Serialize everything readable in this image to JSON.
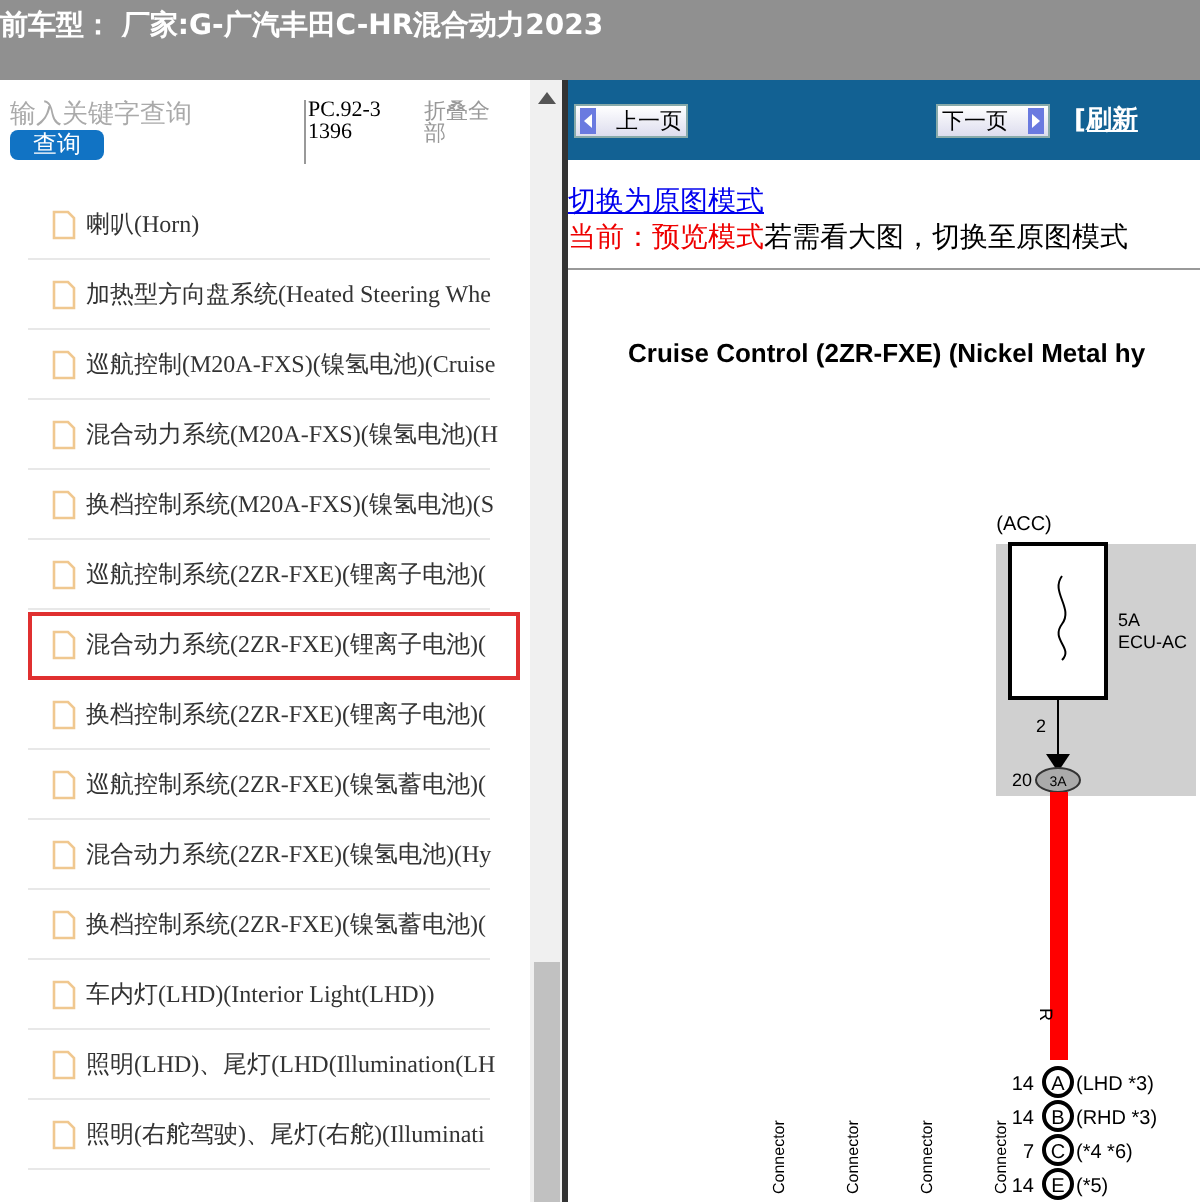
{
  "header": {
    "title": "前车型： 厂家:G-广汽丰田C-HR混合动力2023"
  },
  "search": {
    "placeholder": "输入关键字查询",
    "button": "查询",
    "part_number": "PC.92-31396",
    "collapse": "折叠全部"
  },
  "tree": {
    "items": [
      {
        "label": "喇叭(Horn)",
        "selected": false
      },
      {
        "label": "加热型方向盘系统(Heated Steering Whe",
        "selected": false
      },
      {
        "label": "巡航控制(M20A-FXS)(镍氢电池)(Cruise",
        "selected": false
      },
      {
        "label": "混合动力系统(M20A-FXS)(镍氢电池)(H",
        "selected": false
      },
      {
        "label": "换档控制系统(M20A-FXS)(镍氢电池)(S",
        "selected": false
      },
      {
        "label": "巡航控制系统(2ZR-FXE)(锂离子电池)(",
        "selected": false
      },
      {
        "label": "混合动力系统(2ZR-FXE)(锂离子电池)(",
        "selected": true
      },
      {
        "label": "换档控制系统(2ZR-FXE)(锂离子电池)(",
        "selected": false
      },
      {
        "label": "巡航控制系统(2ZR-FXE)(镍氢蓄电池)(",
        "selected": false
      },
      {
        "label": "混合动力系统(2ZR-FXE)(镍氢电池)(Hy",
        "selected": false
      },
      {
        "label": "换档控制系统(2ZR-FXE)(镍氢蓄电池)(",
        "selected": false
      },
      {
        "label": "车内灯(LHD)(Interior Light(LHD))",
        "selected": false
      },
      {
        "label": "照明(LHD)、尾灯(LHD(Illumination(LH",
        "selected": false
      },
      {
        "label": "照明(右舵驾驶)、尾灯(右舵)(Illuminati",
        "selected": false
      }
    ]
  },
  "viewer": {
    "prev": "上一页",
    "next": "下一页",
    "refresh": "[刷新",
    "mode_link": "切换为原图模式",
    "mode_status": "当前：预览模式",
    "mode_hint": "若需看大图，切换至原图模式",
    "diagram": {
      "title": "Cruise Control (2ZR-FXE) (Nickel Metal hy",
      "acc": "(ACC)",
      "fuse_rating": "5A",
      "fuse_name": "ECU-AC",
      "pin": "2",
      "connector": "3A",
      "connector_pin": "20",
      "wire_color": "R",
      "junctions": [
        {
          "pin": "14",
          "letter": "A",
          "note": "(LHD *3)"
        },
        {
          "pin": "14",
          "letter": "B",
          "note": "(RHD *3)"
        },
        {
          "pin": "7",
          "letter": "C",
          "note": "(*4 *6)"
        },
        {
          "pin": "14",
          "letter": "E",
          "note": "(*5)"
        }
      ],
      "connector_labels": [
        "Connector",
        "Connector",
        "Connector",
        "Connector"
      ]
    }
  }
}
